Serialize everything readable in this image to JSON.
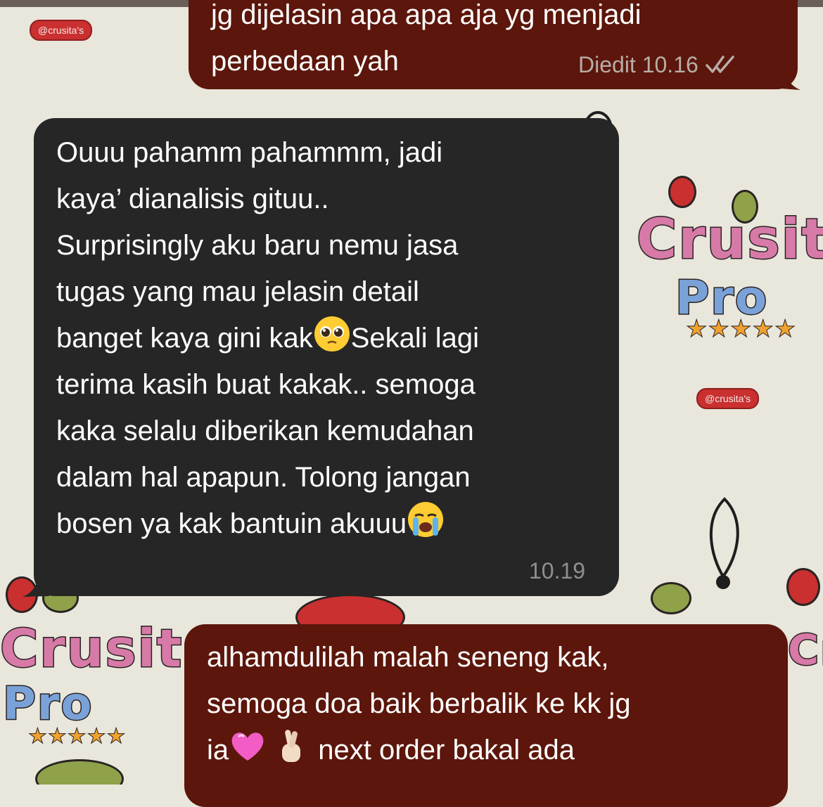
{
  "wallpaper": {
    "sticker_label": "@crusita's",
    "brand_top": "Crusit",
    "brand_bottom": "Pro",
    "stars": "★★★★★"
  },
  "messages": [
    {
      "direction": "outgoing",
      "lines": [
        "jg dijelasin apa apa aja yg menjadi",
        "perbedaan yah"
      ],
      "edited_label": "Diedit",
      "time": "10.16",
      "status_icon": "double-check-icon"
    },
    {
      "direction": "incoming",
      "lines": [
        "Ouuu pahamm pahammm, jadi",
        "kaya’ dianalisis gituu..",
        "Surprisingly aku baru nemu jasa",
        "tugas yang mau jelasin detail",
        "banget kaya gini kak",
        "Sekali lagi",
        "terima kasih buat kakak.. semoga",
        "kaka selalu diberikan kemudahan",
        "dalam hal apapun. Tolong jangan",
        "bosen ya kak bantuin akuuu"
      ],
      "emojis": [
        "pleading-face-icon",
        "loudly-crying-face-icon"
      ],
      "time": "10.19"
    },
    {
      "direction": "outgoing",
      "lines": [
        "alhamdulilah malah seneng kak,",
        "semoga doa baik berbalik ke kk jg",
        "ia",
        " next order bakal ada"
      ],
      "emojis": [
        "pink-heart-icon",
        "crossed-fingers-icon"
      ]
    }
  ],
  "colors": {
    "outgoing_bubble": "#5c160b",
    "incoming_bubble": "#262626",
    "wallpaper": "#e9e6dc",
    "meta_text": "#b7ada8"
  }
}
